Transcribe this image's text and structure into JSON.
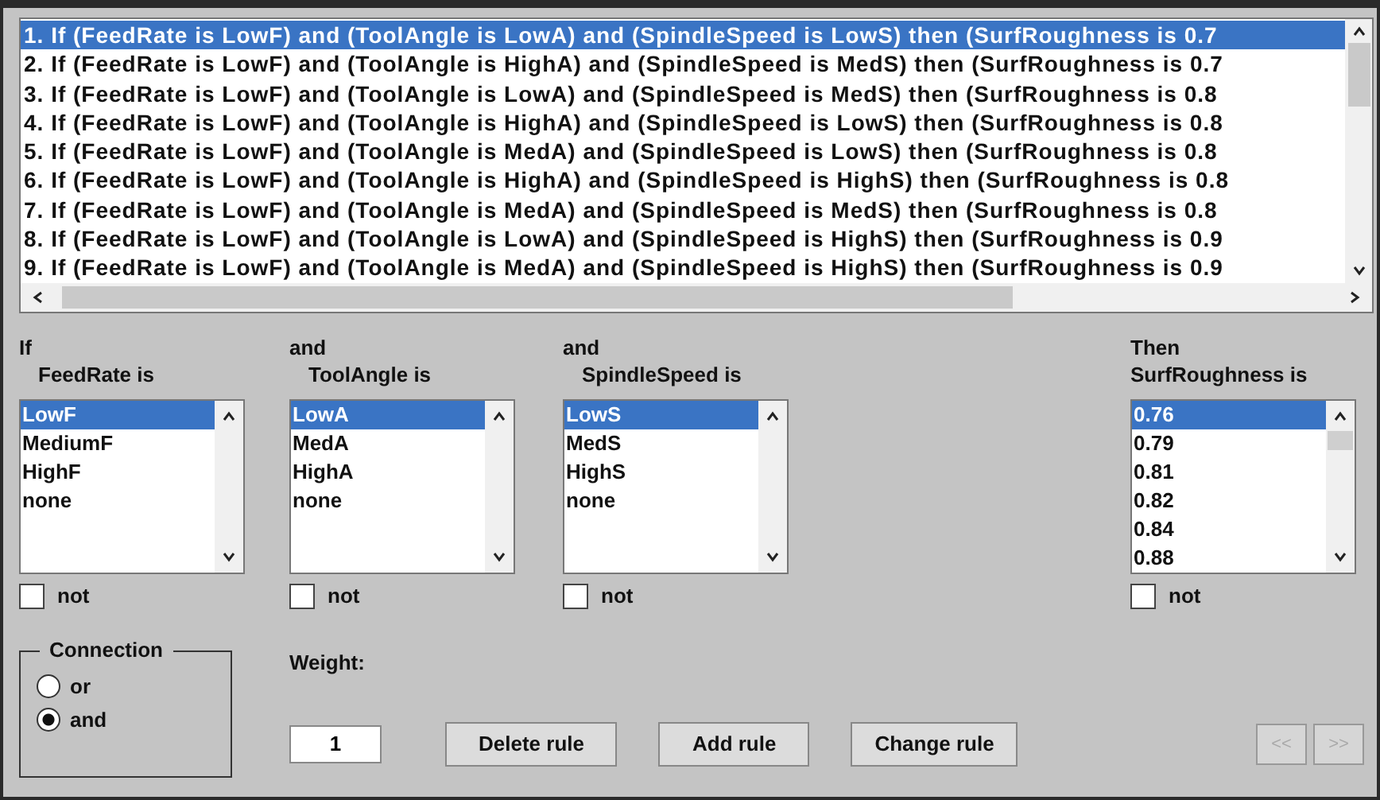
{
  "rules": [
    {
      "text": "1. If (FeedRate is LowF) and (ToolAngle is LowA) and (SpindleSpeed is LowS) then (SurfRoughness is 0.7",
      "selected": true
    },
    {
      "text": "2. If (FeedRate is LowF) and (ToolAngle is HighA) and (SpindleSpeed is MedS) then (SurfRoughness is 0.7",
      "selected": false
    },
    {
      "text": "3. If (FeedRate is LowF) and (ToolAngle is LowA) and (SpindleSpeed is MedS) then (SurfRoughness is 0.8",
      "selected": false
    },
    {
      "text": "4. If (FeedRate is LowF) and (ToolAngle is HighA) and (SpindleSpeed is LowS) then (SurfRoughness is 0.8",
      "selected": false
    },
    {
      "text": "5. If (FeedRate is LowF) and (ToolAngle is MedA) and (SpindleSpeed is LowS) then (SurfRoughness is 0.8",
      "selected": false
    },
    {
      "text": "6. If (FeedRate is LowF) and (ToolAngle is HighA) and (SpindleSpeed is HighS) then (SurfRoughness is 0.8",
      "selected": false
    },
    {
      "text": "7. If (FeedRate is LowF) and (ToolAngle is MedA) and (SpindleSpeed is MedS) then (SurfRoughness is 0.8",
      "selected": false
    },
    {
      "text": "8. If (FeedRate is LowF) and (ToolAngle is LowA) and (SpindleSpeed is HighS) then (SurfRoughness is 0.9",
      "selected": false
    },
    {
      "text": "9. If (FeedRate is LowF) and (ToolAngle is MedA) and (SpindleSpeed is HighS) then (SurfRoughness is 0.9",
      "selected": false
    }
  ],
  "variables": [
    {
      "connector": "If",
      "label": "FeedRate is",
      "not_checked": false,
      "not_label": "not",
      "items": [
        {
          "text": "LowF",
          "selected": true
        },
        {
          "text": "MediumF",
          "selected": false
        },
        {
          "text": "HighF",
          "selected": false
        },
        {
          "text": "none",
          "selected": false
        }
      ]
    },
    {
      "connector": "and",
      "label": "ToolAngle is",
      "not_checked": false,
      "not_label": "not",
      "items": [
        {
          "text": "LowA",
          "selected": true
        },
        {
          "text": "MedA",
          "selected": false
        },
        {
          "text": "HighA",
          "selected": false
        },
        {
          "text": "none",
          "selected": false
        }
      ]
    },
    {
      "connector": "and",
      "label": "SpindleSpeed is",
      "not_checked": false,
      "not_label": "not",
      "items": [
        {
          "text": "LowS",
          "selected": true
        },
        {
          "text": "MedS",
          "selected": false
        },
        {
          "text": "HighS",
          "selected": false
        },
        {
          "text": "none",
          "selected": false
        }
      ]
    }
  ],
  "output": {
    "connector": "Then",
    "label": "SurfRoughness is",
    "not_checked": false,
    "not_label": "not",
    "items": [
      {
        "text": "0.76",
        "selected": true
      },
      {
        "text": "0.79",
        "selected": false
      },
      {
        "text": "0.81",
        "selected": false
      },
      {
        "text": "0.82",
        "selected": false
      },
      {
        "text": "0.84",
        "selected": false
      },
      {
        "text": "0.88",
        "selected": false
      }
    ]
  },
  "connection": {
    "title": "Connection",
    "options": [
      {
        "label": "or",
        "selected": false
      },
      {
        "label": "and",
        "selected": true
      }
    ]
  },
  "weight": {
    "label": "Weight:",
    "value": "1"
  },
  "buttons": [
    {
      "label": "Delete rule",
      "disabled": false
    },
    {
      "label": "Add rule",
      "disabled": false
    },
    {
      "label": "Change rule",
      "disabled": false
    }
  ],
  "nav_buttons": [
    {
      "label": "<<",
      "disabled": true
    },
    {
      "label": ">>",
      "disabled": true
    }
  ]
}
